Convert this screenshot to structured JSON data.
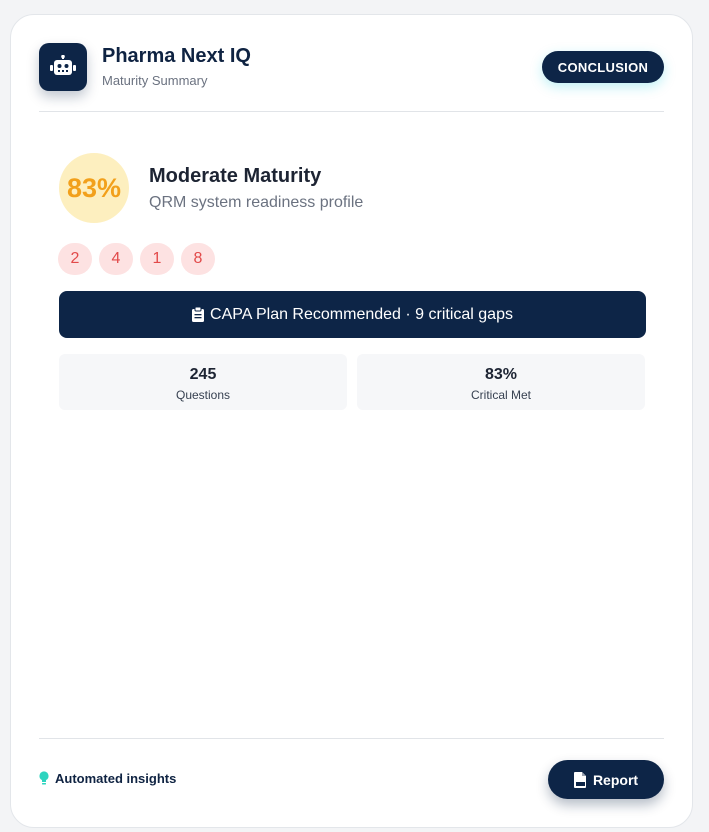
{
  "header": {
    "title": "Pharma Next IQ",
    "subtitle": "Maturity Summary",
    "conclusion_label": "CONCLUSION",
    "app_icon": "robot-icon"
  },
  "score": {
    "value": "83%",
    "label": "Moderate Maturity",
    "description": "QRM system readiness profile",
    "color": "#f2a01b"
  },
  "badges": [
    "2",
    "4",
    "1",
    "8"
  ],
  "capa": {
    "icon": "clipboard-icon",
    "text": "CAPA Plan Recommended · 9 critical gaps"
  },
  "stats": [
    {
      "value": "245",
      "label": "Questions"
    },
    {
      "value": "83%",
      "label": "Critical Met"
    }
  ],
  "footer": {
    "insights_icon": "lightbulb-icon",
    "insights_label": "Automated insights",
    "report_icon": "pdf-file-icon",
    "report_label": "Report"
  },
  "colors": {
    "primary": "#0d2547",
    "badge_bg": "#fde2e2",
    "badge_text": "#e24a4a",
    "accent": "#2dd4bf"
  }
}
